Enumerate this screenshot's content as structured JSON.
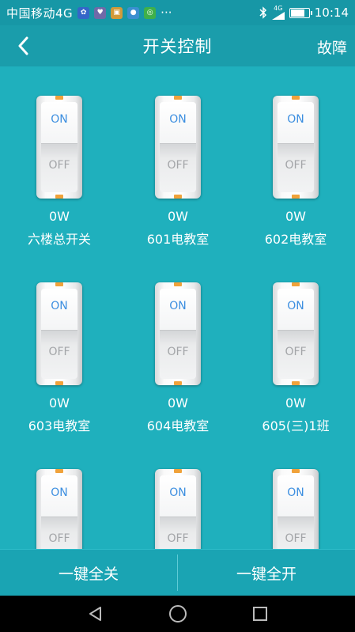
{
  "status_bar": {
    "carrier": "中国移动4G",
    "network_badge": "4G",
    "time": "10:14",
    "battery_level": 0.85,
    "more": "···"
  },
  "header": {
    "title": "开关控制",
    "right_action": "故障"
  },
  "switch_labels": {
    "on": "ON",
    "off": "OFF"
  },
  "switches": [
    {
      "power": "0W",
      "name": "六楼总开关"
    },
    {
      "power": "0W",
      "name": "601电教室"
    },
    {
      "power": "0W",
      "name": "602电教室"
    },
    {
      "power": "0W",
      "name": "603电教室"
    },
    {
      "power": "0W",
      "name": "604电教室"
    },
    {
      "power": "0W",
      "name": "605(三)1班"
    },
    {
      "power": "",
      "name": ""
    },
    {
      "power": "",
      "name": ""
    },
    {
      "power": "",
      "name": ""
    }
  ],
  "bottom_buttons": {
    "all_off": "一键全关",
    "all_on": "一键全开"
  },
  "colors": {
    "background": "#1fb0bd",
    "header": "#1a9dab",
    "status_bar": "#1797a6",
    "switch_on_text": "#3d8fe0",
    "switch_tab": "#f0a23a"
  }
}
